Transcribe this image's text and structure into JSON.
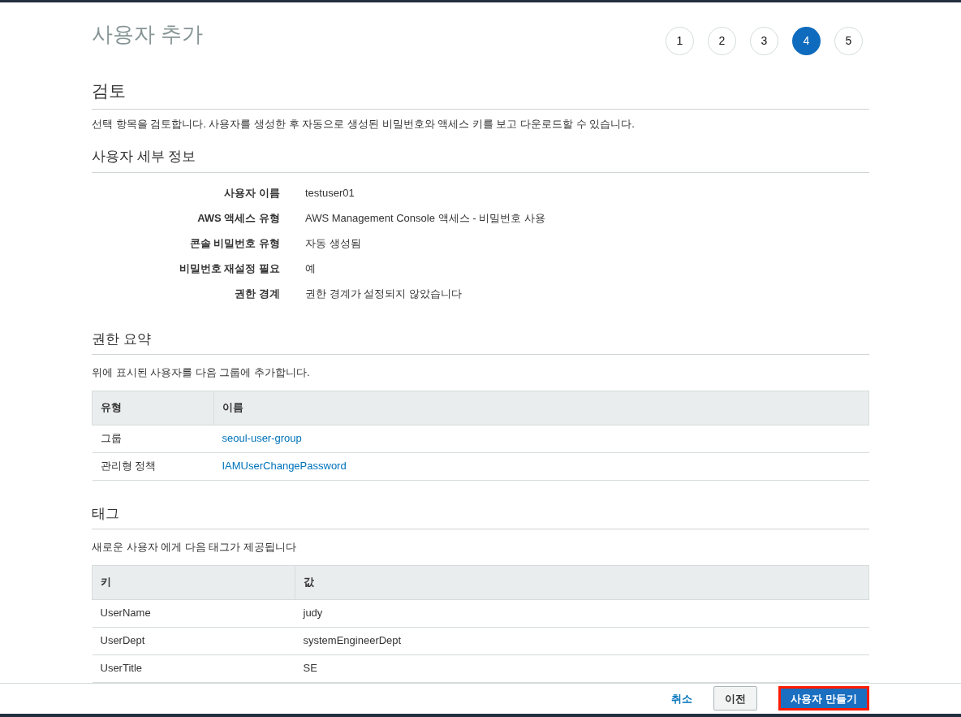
{
  "page_title": "사용자 추가",
  "steps": [
    {
      "label": "1",
      "selected": false
    },
    {
      "label": "2",
      "selected": false
    },
    {
      "label": "3",
      "selected": false
    },
    {
      "label": "4",
      "selected": true
    },
    {
      "label": "5",
      "selected": false
    }
  ],
  "review": {
    "heading": "검토",
    "description": "선택 항목을 검토합니다. 사용자를 생성한 후 자동으로 생성된 비밀번호와 액세스 키를 보고 다운로드할 수 있습니다."
  },
  "user_details": {
    "heading": "사용자 세부 정보",
    "rows": [
      {
        "label": "사용자 이름",
        "value": "testuser01"
      },
      {
        "label": "AWS 액세스 유형",
        "value": "AWS Management Console 액세스 - 비밀번호 사용"
      },
      {
        "label": "콘솔 비밀번호 유형",
        "value": "자동 생성됨"
      },
      {
        "label": "비밀번호 재설정 필요",
        "value": "예"
      },
      {
        "label": "권한 경계",
        "value": "권한 경계가 설정되지 않았습니다"
      }
    ]
  },
  "permissions": {
    "heading": "권한 요약",
    "description": "위에 표시된 사용자를 다음 그룹에 추가합니다.",
    "table": {
      "columns": [
        "유형",
        "이름"
      ],
      "rows": [
        [
          "그룹",
          "seoul-user-group"
        ],
        [
          "관리형 정책",
          "IAMUserChangePassword"
        ]
      ]
    }
  },
  "tags": {
    "heading": "태그",
    "description": "새로운 사용자 에게 다음 태그가 제공됩니다",
    "table": {
      "columns": [
        "키",
        "값"
      ],
      "rows": [
        [
          "UserName",
          "judy"
        ],
        [
          "UserDept",
          "systemEngineerDept"
        ],
        [
          "UserTitle",
          "SE"
        ]
      ]
    }
  },
  "footer": {
    "cancel": "취소",
    "previous": "이전",
    "create": {
      "label": "사용자 만들기",
      "highlighted": true
    }
  }
}
